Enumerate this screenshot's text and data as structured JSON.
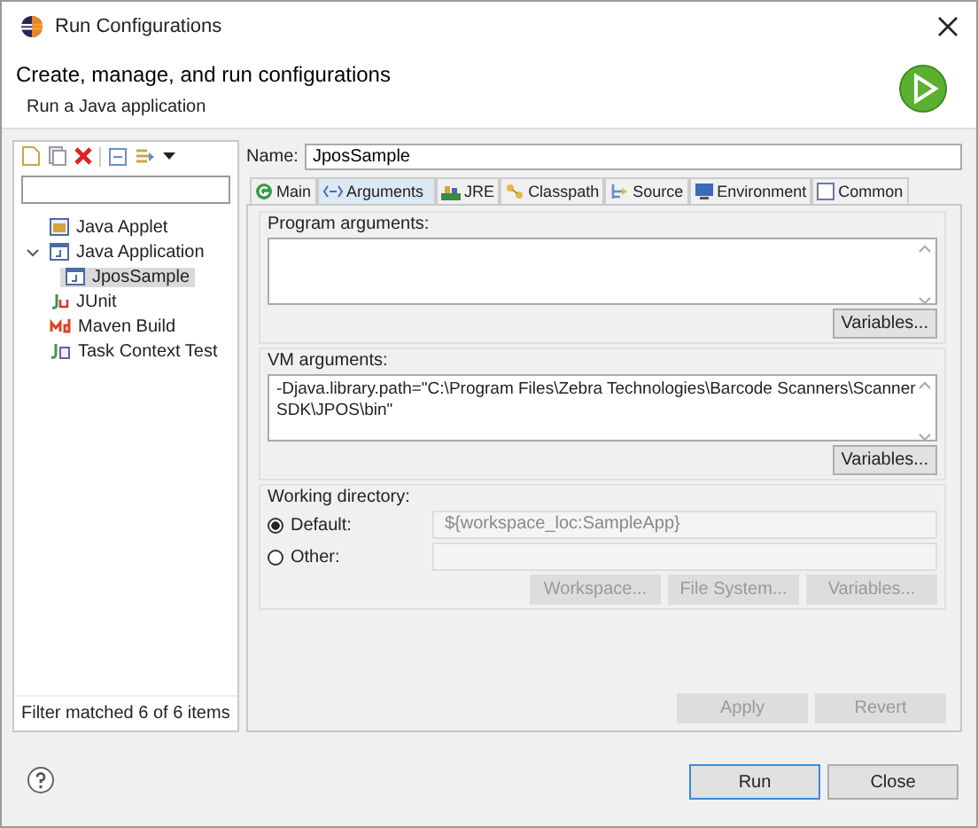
{
  "window": {
    "title": "Run Configurations"
  },
  "header": {
    "title": "Create, manage, and run configurations",
    "subtitle": "Run a Java application"
  },
  "sidebar": {
    "tree": [
      {
        "label": "Java Applet",
        "kind": "applet",
        "selected": false
      },
      {
        "label": "Java Application",
        "kind": "application",
        "selected": false,
        "expanded": true,
        "children": [
          {
            "label": "JposSample",
            "kind": "application",
            "selected": true
          }
        ]
      },
      {
        "label": "JUnit",
        "kind": "junit",
        "selected": false
      },
      {
        "label": "Maven Build",
        "kind": "maven",
        "selected": false
      },
      {
        "label": "Task Context Test",
        "kind": "task",
        "selected": false
      }
    ],
    "status": "Filter matched 6 of 6 items"
  },
  "name": {
    "label": "Name:",
    "value": "JposSample"
  },
  "tabs": [
    {
      "label": "Main",
      "kind": "main",
      "selected": false
    },
    {
      "label": "Arguments",
      "kind": "arguments",
      "selected": true
    },
    {
      "label": "JRE",
      "kind": "jre",
      "selected": false
    },
    {
      "label": "Classpath",
      "kind": "classpath",
      "selected": false
    },
    {
      "label": "Source",
      "kind": "source",
      "selected": false
    },
    {
      "label": "Environment",
      "kind": "environment",
      "selected": false
    },
    {
      "label": "Common",
      "kind": "common",
      "selected": false
    }
  ],
  "program_arguments": {
    "label": "Program arguments:",
    "button": {
      "label": "Variables...",
      "disabled": false
    }
  },
  "vm_arguments": {
    "label": "VM arguments:",
    "value": "-Djava.library.path=\"C:\\Program Files\\Zebra Technologies\\Barcode Scanners\\Scanner SDK\\JPOS\\bin\"",
    "button": {
      "label": "Variables...",
      "disabled": false
    }
  },
  "working_directory": {
    "label": "Working directory:",
    "options": [
      {
        "label": "Default:",
        "selected": true,
        "value": "${workspace_loc:SampleApp}"
      },
      {
        "label": "Other:",
        "selected": false
      }
    ],
    "buttons": [
      {
        "label": "Workspace...",
        "disabled": true
      },
      {
        "label": "File System...",
        "disabled": true
      },
      {
        "label": "Variables...",
        "disabled": true
      }
    ]
  },
  "config_buttons": [
    {
      "label": "Apply",
      "disabled": true
    },
    {
      "label": "Revert",
      "disabled": true
    }
  ],
  "dialog_buttons": [
    {
      "label": "Run",
      "disabled": false,
      "default": true
    },
    {
      "label": "Close",
      "disabled": false,
      "default": false
    }
  ]
}
